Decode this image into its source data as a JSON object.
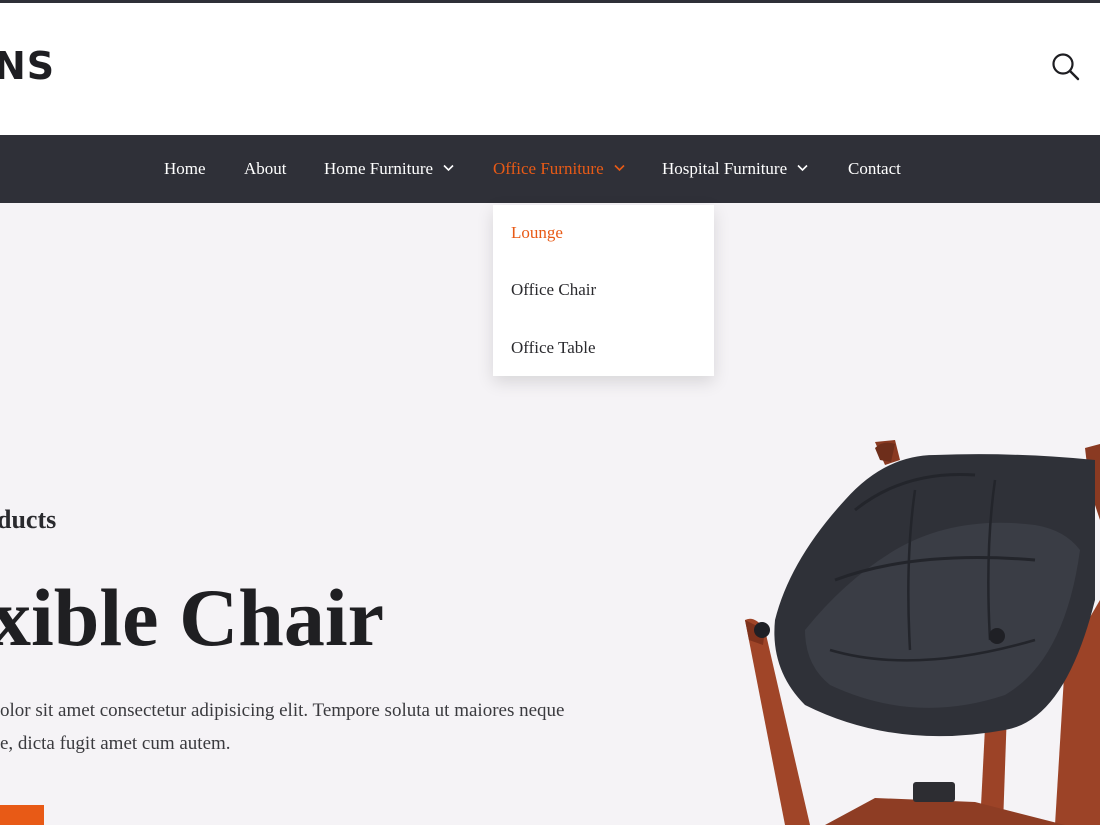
{
  "header": {
    "logo_text": "NS",
    "search_icon": "search-icon"
  },
  "nav": {
    "items": [
      {
        "label": "Home",
        "has_dropdown": false
      },
      {
        "label": "About",
        "has_dropdown": false
      },
      {
        "label": "Home Furniture",
        "has_dropdown": true
      },
      {
        "label": "Office Furniture",
        "has_dropdown": true,
        "active": true
      },
      {
        "label": "Hospital Furniture",
        "has_dropdown": true
      },
      {
        "label": "Contact",
        "has_dropdown": false
      }
    ],
    "dropdown_icon": "chevron-down-icon"
  },
  "dropdown": {
    "items": [
      {
        "label": "Lounge",
        "active": true
      },
      {
        "label": "Office Chair"
      },
      {
        "label": "Office Table"
      }
    ]
  },
  "hero": {
    "subtitle": "ducts",
    "title": "xible Chair",
    "text_line1": "olor sit amet consectetur adipisicing elit. Tempore soluta ut maiores neque",
    "text_line2": "e, dicta fugit amet cum autem."
  },
  "colors": {
    "accent": "#e85a16",
    "nav_bg": "#2f3038",
    "page_bg": "#f5f3f6"
  }
}
